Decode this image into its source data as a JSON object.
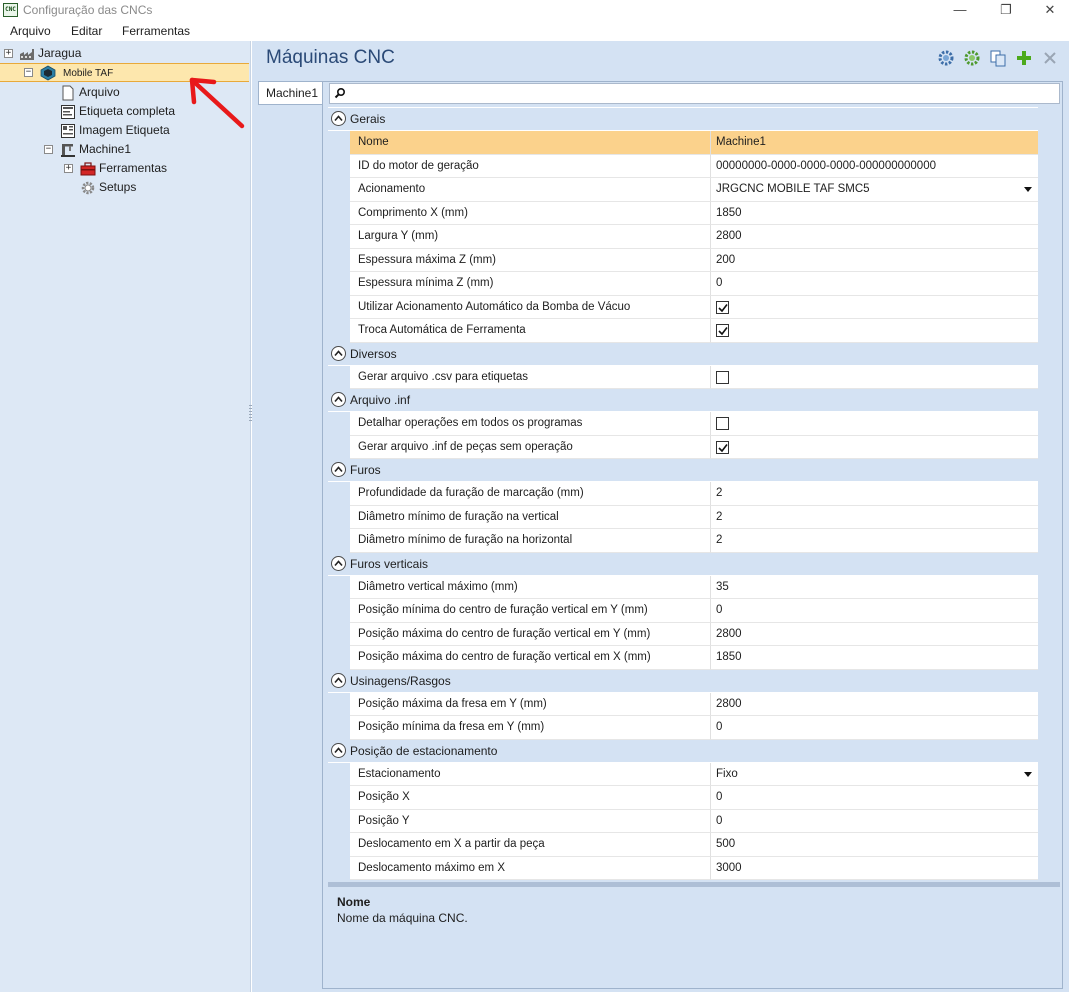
{
  "window": {
    "icon_text": "CNC",
    "title": "Configuração das CNCs",
    "minimize": "—",
    "restore": "❐",
    "close": "✕"
  },
  "menu": [
    "Arquivo",
    "Editar",
    "Ferramentas"
  ],
  "tree": {
    "root": "Jaragua",
    "selected": "Mobile TAF",
    "items": [
      "Arquivo",
      "Etiqueta completa",
      "Imagem Etiqueta"
    ],
    "machine": "Machine1",
    "machine_children": [
      "Ferramentas",
      "Setups"
    ]
  },
  "header": {
    "title": "Máquinas CNC",
    "tools": [
      "settings-gear-blue-icon",
      "settings-gear-green-icon",
      "copy-icon",
      "add-icon",
      "delete-icon"
    ]
  },
  "tab": "Machine1",
  "search": {
    "value": ""
  },
  "grid": {
    "categories": [
      {
        "name": "Gerais",
        "rows": [
          {
            "name": "Nome",
            "value": "Machine1",
            "selected": true
          },
          {
            "name": "ID do motor de geração",
            "value": "00000000-0000-0000-0000-000000000000"
          },
          {
            "name": "Acionamento",
            "value": "JRGCNC MOBILE TAF SMC5",
            "dropdown": true
          },
          {
            "name": "Comprimento X (mm)",
            "value": "1850"
          },
          {
            "name": "Largura Y (mm)",
            "value": "2800"
          },
          {
            "name": "Espessura máxima Z (mm)",
            "value": "200"
          },
          {
            "name": "Espessura mínima Z (mm)",
            "value": "0"
          },
          {
            "name": "Utilizar Acionamento Automático da Bomba de Vácuo",
            "checked": true
          },
          {
            "name": "Troca Automática de Ferramenta",
            "checked": true
          }
        ]
      },
      {
        "name": "Diversos",
        "rows": [
          {
            "name": "Gerar arquivo .csv para etiquetas",
            "checked": false
          }
        ]
      },
      {
        "name": "Arquivo .inf",
        "rows": [
          {
            "name": "Detalhar operações em todos os programas",
            "checked": false
          },
          {
            "name": "Gerar arquivo .inf de peças sem operação",
            "checked": true
          }
        ]
      },
      {
        "name": "Furos",
        "rows": [
          {
            "name": "Profundidade da furação de marcação (mm)",
            "value": "2"
          },
          {
            "name": "Diâmetro mínimo de furação na vertical",
            "value": "2"
          },
          {
            "name": "Diâmetro mínimo de furação na horizontal",
            "value": "2"
          }
        ]
      },
      {
        "name": "Furos verticais",
        "rows": [
          {
            "name": "Diâmetro vertical máximo (mm)",
            "value": "35"
          },
          {
            "name": "Posição mínima do centro de furação vertical em Y (mm)",
            "value": "0"
          },
          {
            "name": "Posição máxima do centro de furação vertical em Y (mm)",
            "value": "2800"
          },
          {
            "name": "Posição máxima do centro de furação vertical em X (mm)",
            "value": "1850"
          }
        ]
      },
      {
        "name": "Usinagens/Rasgos",
        "rows": [
          {
            "name": "Posição máxima da fresa em Y (mm)",
            "value": "2800"
          },
          {
            "name": "Posição mínima da fresa em Y (mm)",
            "value": "0"
          }
        ]
      },
      {
        "name": "Posição de estacionamento",
        "rows": [
          {
            "name": "Estacionamento",
            "value": "Fixo",
            "dropdown": true
          },
          {
            "name": "Posição X",
            "value": "0"
          },
          {
            "name": "Posição Y",
            "value": "0"
          },
          {
            "name": "Deslocamento em X a partir da peça",
            "value": "500"
          },
          {
            "name": "Deslocamento máximo em X",
            "value": "3000"
          }
        ]
      }
    ]
  },
  "description": {
    "title": "Nome",
    "text": "Nome da máquina CNC."
  }
}
